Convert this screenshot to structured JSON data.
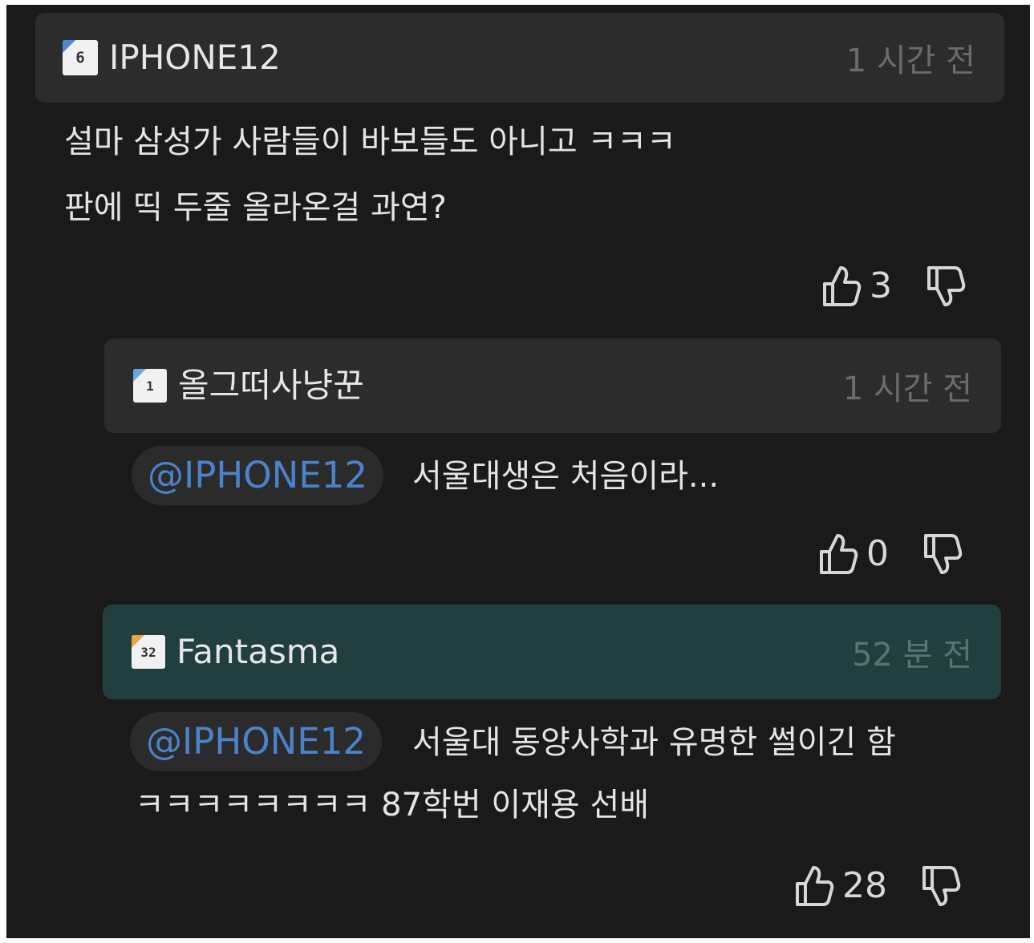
{
  "comments": [
    {
      "level": 1,
      "username": "IPHONE12",
      "time": "1 시간 전",
      "text_lines": [
        "설마 삼성가 사람들이 바보들도 아니고 ㅋㅋㅋ",
        "판에 띡 두줄 올라온걸 과연?"
      ],
      "likes": "3",
      "header_color": "#2c2c2c"
    },
    {
      "level": 2,
      "username": "올그떠사냥꾼",
      "time": "1 시간 전",
      "mention": "@IPHONE12",
      "text": "서울대생은 처음이라...",
      "likes": "0",
      "header_color": "#2c2c2c"
    },
    {
      "level": 2,
      "username": "Fantasma",
      "time": "52 분 전",
      "mention": "@IPHONE12",
      "text": "서울대 동양사학과 유명한 썰이긴 함",
      "text_line2": "ㅋㅋㅋㅋㅋㅋㅋㅋ 87학번 이재용 선배",
      "likes": "28",
      "header_color": "#213f3e"
    }
  ],
  "badges": [
    {
      "label": "6",
      "corner_color": "#4f86d6"
    },
    {
      "label": "1",
      "corner_color": "#6aa7df"
    },
    {
      "label": "32",
      "corner_color": "#e7a44a"
    }
  ],
  "icons": {
    "like": "thumbs-up-icon",
    "dislike": "thumbs-down-icon"
  }
}
